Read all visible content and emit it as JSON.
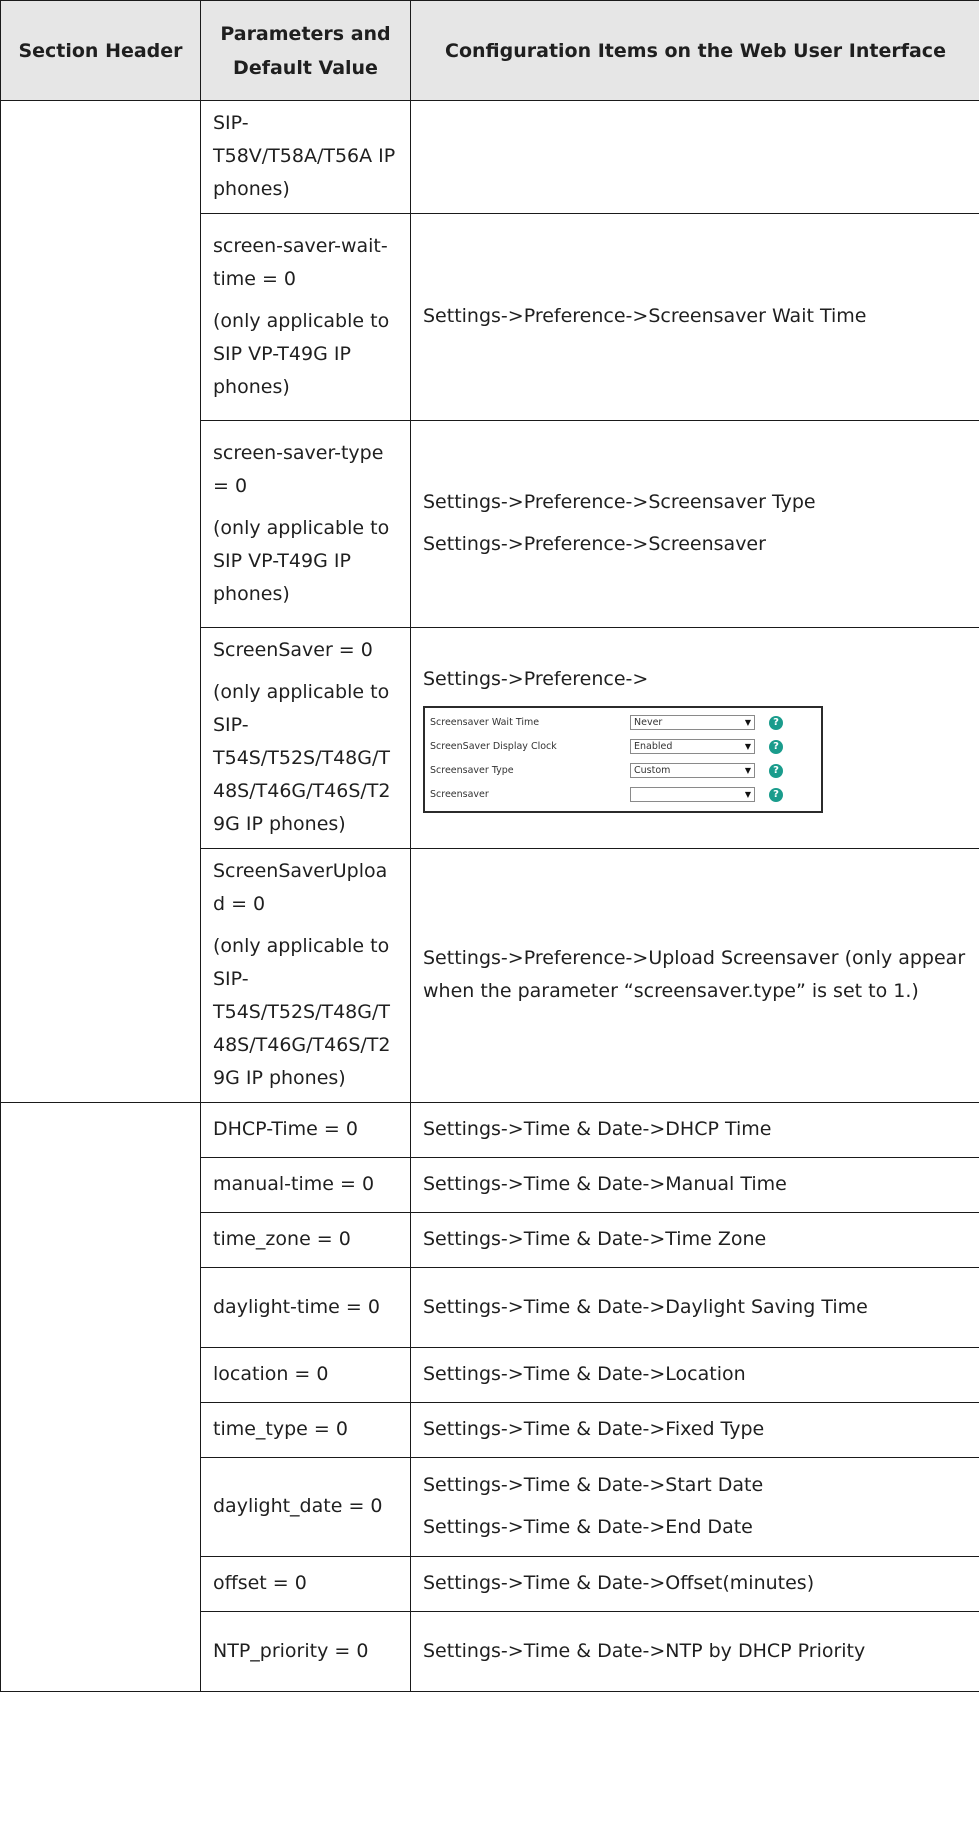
{
  "table": {
    "headers": {
      "section": "Section Header",
      "parameters": "Parameters and Default Value",
      "config": "Configuration Items on the Web User Interface"
    },
    "rows": [
      {
        "param": [
          "SIP-T58V/T58A/T56A IP phones)"
        ],
        "config": []
      },
      {
        "param": [
          "screen-saver-wait-time = 0",
          "(only applicable to SIP VP-T49G IP phones)"
        ],
        "config": [
          "Settings->Preference->Screensaver Wait Time"
        ]
      },
      {
        "param": [
          "screen-saver-type = 0",
          "(only applicable to SIP VP-T49G IP phones)"
        ],
        "config": [
          "Settings->Preference->Screensaver Type",
          "Settings->Preference->Screensaver"
        ]
      },
      {
        "param": [
          "ScreenSaver = 0",
          "(only applicable to SIP-T54S/T52S/T48G/T48S/T46G/T46S/T29G IP phones)"
        ],
        "config": [
          "Settings->Preference->"
        ]
      },
      {
        "param": [
          "ScreenSaverUpload = 0",
          "(only applicable to SIP-T54S/T52S/T48G/T48S/T46G/T46S/T29G IP phones)"
        ],
        "config": [
          "Settings->Preference->Upload Screensaver (only appear when the parameter “screensaver.type” is set to 1.)"
        ]
      },
      {
        "param": [
          "DHCP-Time = 0"
        ],
        "config": [
          "Settings->Time & Date->DHCP Time"
        ]
      },
      {
        "param": [
          "manual-time = 0"
        ],
        "config": [
          "Settings->Time & Date->Manual Time"
        ]
      },
      {
        "param": [
          "time_zone = 0"
        ],
        "config": [
          "Settings->Time & Date->Time Zone"
        ]
      },
      {
        "param": [
          "daylight-time = 0"
        ],
        "config": [
          "Settings->Time & Date->Daylight Saving Time"
        ]
      },
      {
        "param": [
          "location = 0"
        ],
        "config": [
          "Settings->Time & Date->Location"
        ]
      },
      {
        "param": [
          "time_type = 0"
        ],
        "config": [
          "Settings->Time & Date->Fixed Type"
        ]
      },
      {
        "param": [
          "daylight_date = 0"
        ],
        "config": [
          "Settings->Time & Date->Start Date",
          "Settings->Time & Date->End Date"
        ]
      },
      {
        "param": [
          "offset = 0"
        ],
        "config": [
          "Settings->Time & Date->Offset(minutes)"
        ]
      },
      {
        "param": [
          "NTP_priority = 0"
        ],
        "config": [
          "Settings->Time & Date->NTP by DHCP Priority"
        ]
      }
    ]
  },
  "screenshot": {
    "rows": [
      {
        "label": "Screensaver Wait Time",
        "value": "Never",
        "icon": "help-icon"
      },
      {
        "label": "ScreenSaver Display Clock",
        "value": "Enabled",
        "icon": "help-icon"
      },
      {
        "label": "Screensaver Type",
        "value": "Custom",
        "icon": "help-icon"
      },
      {
        "label": "Screensaver",
        "value": "",
        "icon": "help-icon"
      }
    ],
    "arrow": "▼",
    "help_glyph": "?",
    "accent_color": "#1a9c8c"
  }
}
